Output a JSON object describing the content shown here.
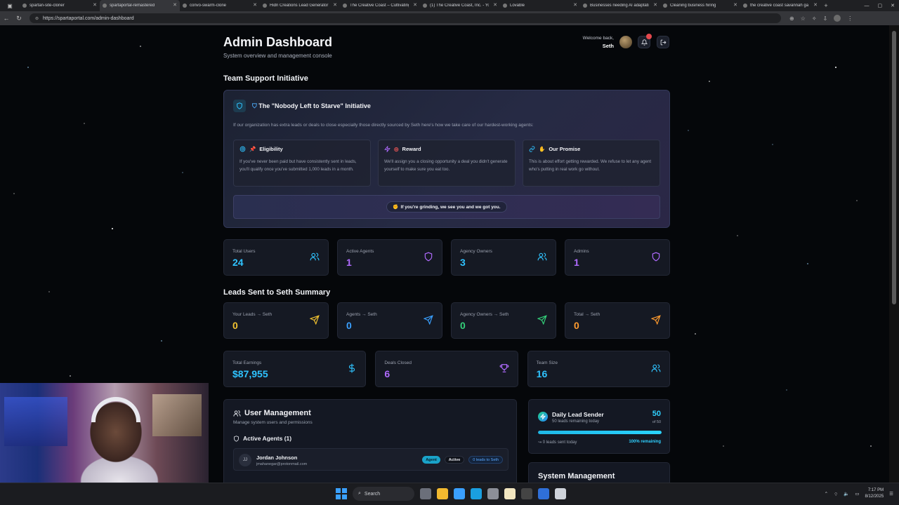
{
  "browser": {
    "tabs": [
      {
        "label": "spartan-site-cloner",
        "active": false
      },
      {
        "label": "spartaportal-remastered",
        "active": true
      },
      {
        "label": "convo-swarm-clone",
        "active": false
      },
      {
        "label": "Hidn Creations Lead Generator",
        "active": false
      },
      {
        "label": "The Creative Coast – Cultivating",
        "active": false
      },
      {
        "label": "(1) The Creative Coast, Inc. - Yo",
        "active": false
      },
      {
        "label": "Lovable",
        "active": false
      },
      {
        "label": "Businesses needing AI adaptatio",
        "active": false
      },
      {
        "label": "Cleaning business hiring",
        "active": false
      },
      {
        "label": "the creative coast savannah ga",
        "active": false
      }
    ],
    "url": "https://spartaportal.com/admin-dashboard"
  },
  "header": {
    "title": "Admin Dashboard",
    "subtitle": "System overview and management console",
    "welcome": "Welcome back,",
    "user_name": "Seth"
  },
  "initiative": {
    "section_title": "Team Support Initiative",
    "title": "The \"Nobody Left to Starve\" Initiative",
    "description": "If our organization has extra leads or deals to close especially those directly sourced by Seth here's how we take care of our hardest-working agents:",
    "cards": [
      {
        "title": "Eligibility",
        "text": "If you've never been paid but have consistently sent in leads, you'll qualify once you've submitted 1,000 leads in a month."
      },
      {
        "title": "Reward",
        "text": "We'll assign you a closing opportunity a deal you didn't generate yourself to make sure you eat too."
      },
      {
        "title": "Our Promise",
        "text": "This is about effort getting rewarded. We refuse to let any agent who's putting in real work go without."
      }
    ],
    "banner": "If you're grinding, we see you and we got you."
  },
  "stats": [
    {
      "label": "Total Users",
      "value": "24",
      "color": "#2fc3ff",
      "icon": "users-icon"
    },
    {
      "label": "Active Agents",
      "value": "1",
      "color": "#b06bff",
      "icon": "shield-icon"
    },
    {
      "label": "Agency Owners",
      "value": "3",
      "color": "#2fc3ff",
      "icon": "users-icon"
    },
    {
      "label": "Admins",
      "value": "1",
      "color": "#b06bff",
      "icon": "shield-icon"
    }
  ],
  "leads_summary": {
    "section_title": "Leads Sent to Seth Summary",
    "cards": [
      {
        "label": "Your Leads → Seth",
        "value": "0",
        "color": "#f2c230",
        "icon": "send-icon"
      },
      {
        "label": "Agents → Seth",
        "value": "0",
        "color": "#3aa0ff",
        "icon": "send-icon"
      },
      {
        "label": "Agency Owners → Seth",
        "value": "0",
        "color": "#34d17a",
        "icon": "send-icon"
      },
      {
        "label": "Total → Seth",
        "value": "0",
        "color": "#ff9b2f",
        "icon": "send-icon"
      }
    ]
  },
  "earnings": [
    {
      "label": "Total Earnings",
      "value": "$87,955",
      "color": "#2fc3ff",
      "icon": "dollar-icon"
    },
    {
      "label": "Deals Closed",
      "value": "6",
      "color": "#b06bff",
      "icon": "trophy-icon"
    },
    {
      "label": "Team Size",
      "value": "16",
      "color": "#2fc3ff",
      "icon": "users-icon"
    }
  ],
  "user_management": {
    "title": "User Management",
    "subtitle": "Manage system users and permissions",
    "active_agents_label": "Active Agents (1)",
    "agents": [
      {
        "initials": "JJ",
        "name": "Jordan Johnson",
        "email": "jmahanegar@protonmail.com",
        "role": "Agent",
        "status": "Active",
        "leads": "0 leads to Seth"
      }
    ]
  },
  "daily_lead_sender": {
    "title": "Daily Lead Sender",
    "subtitle": "50 leads remaining today",
    "count": "50",
    "of_label": "of 50",
    "progress_fraction": 1.0,
    "sent_label": "0 leads sent today",
    "remaining_label": "100% remaining"
  },
  "system_management": {
    "title": "System Management"
  },
  "taskbar": {
    "search_label": "Search",
    "time": "7:17 PM",
    "date": "8/12/2025"
  }
}
